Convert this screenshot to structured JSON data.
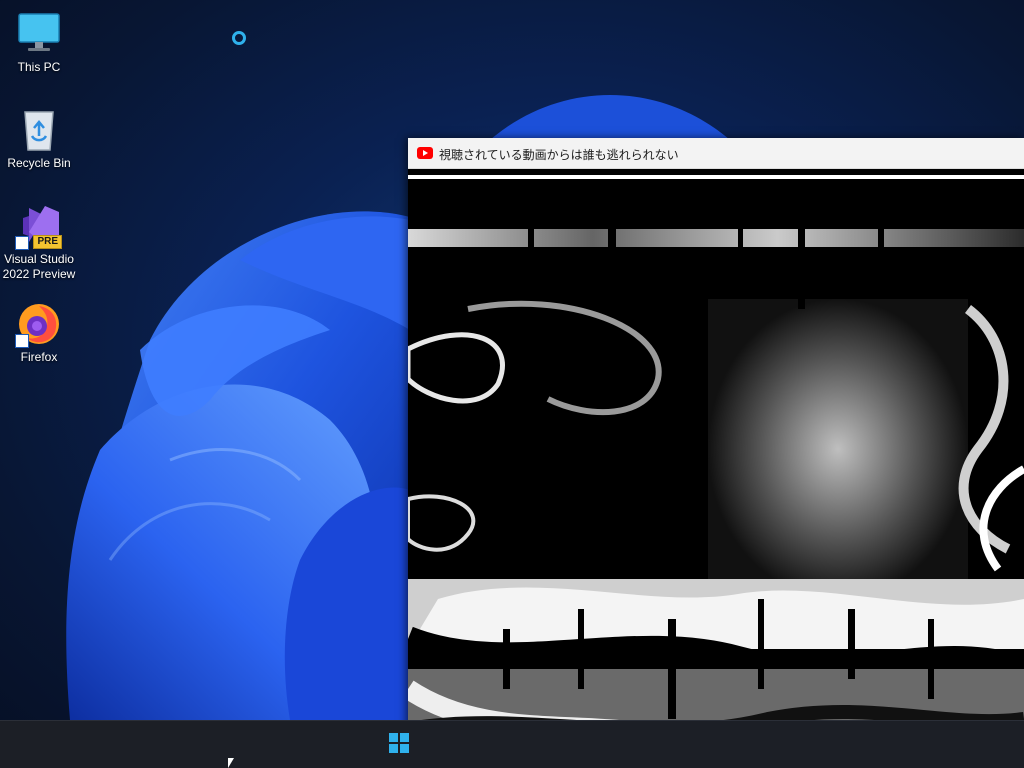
{
  "desktop": {
    "icons": [
      {
        "label": "This PC",
        "icon": "monitor-icon"
      },
      {
        "label": "Recycle Bin",
        "icon": "recycle-bin-icon"
      },
      {
        "label": "Visual Studio 2022 Preview",
        "icon": "visual-studio-icon",
        "badge": "PRE"
      },
      {
        "label": "Firefox",
        "icon": "firefox-icon"
      }
    ]
  },
  "window": {
    "title": "視聴されている動画からは誰も逃れられない",
    "app_icon": "youtube-icon"
  },
  "taskbar": {
    "start_icon": "windows-start-icon",
    "search_icon": "search-icon"
  },
  "colors": {
    "wallpaper_bloom": "#1f56e6",
    "taskbar": "#1c1f26",
    "accent": "#2fb1ec"
  }
}
